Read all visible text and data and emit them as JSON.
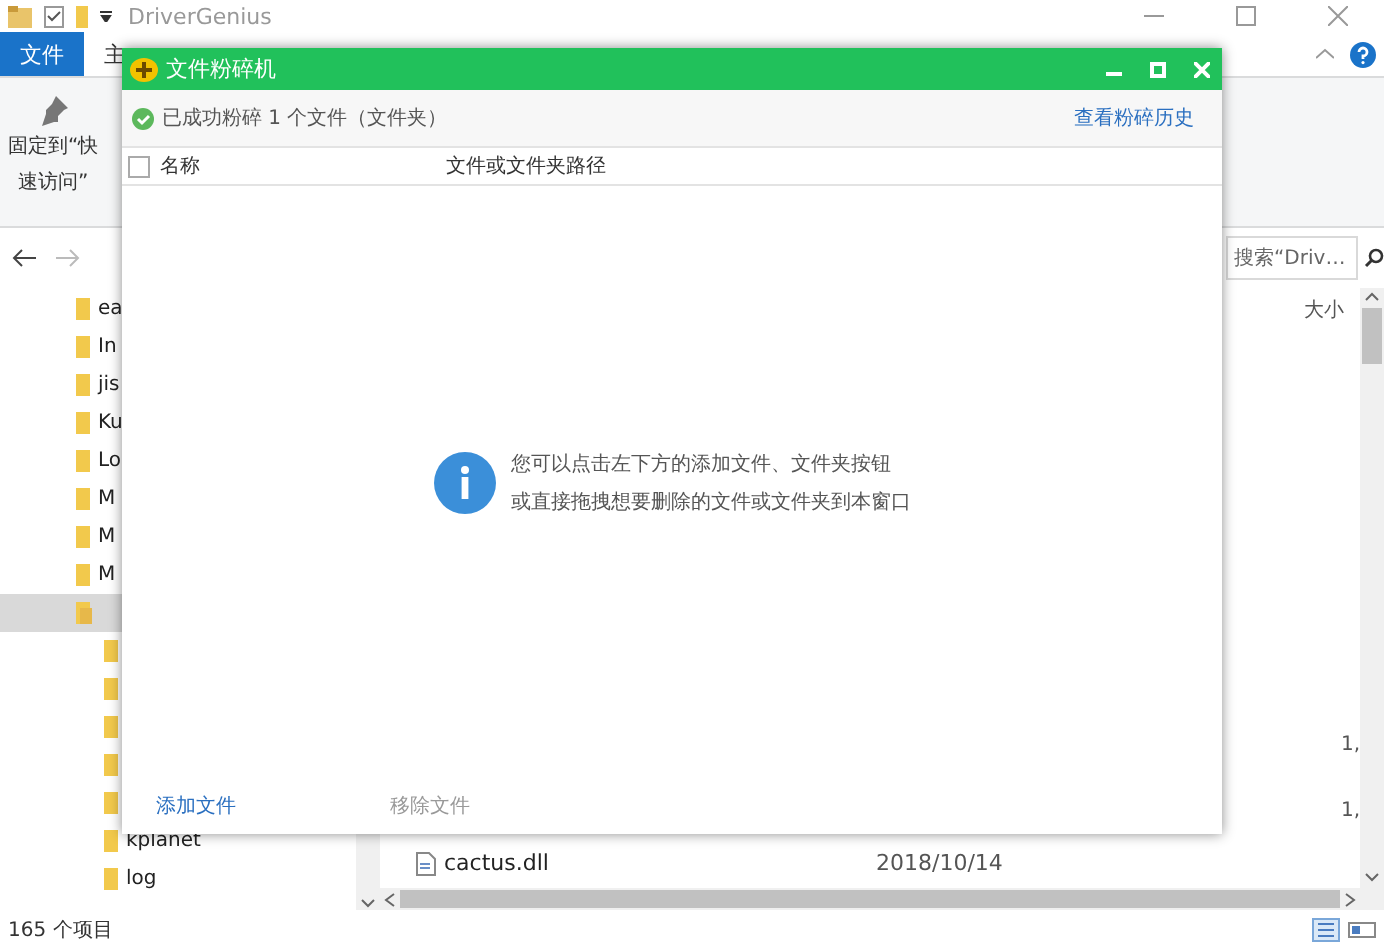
{
  "explorer": {
    "title": "DriverGenius",
    "ribbon_tabs": [
      {
        "label": "文件",
        "selected": true
      },
      {
        "label": "主",
        "selected": false
      }
    ],
    "ribbon_button": [
      "固定到“快",
      "速访问”"
    ],
    "search": {
      "placeholder": "搜索“Driv…"
    },
    "columns": [
      "大小"
    ],
    "nav_items": [
      {
        "kind": "folder",
        "label": "ea"
      },
      {
        "kind": "folder",
        "label": "In"
      },
      {
        "kind": "folder",
        "label": "jis"
      },
      {
        "kind": "folder",
        "label": "Ku"
      },
      {
        "kind": "folder",
        "label": "Lo"
      },
      {
        "kind": "folder",
        "label": "M"
      },
      {
        "kind": "folder",
        "label": "M"
      },
      {
        "kind": "folder",
        "label": "M"
      },
      {
        "kind": "open_folder",
        "selected": true,
        "children": [
          {
            "kind": "folder"
          },
          {
            "kind": "folder"
          },
          {
            "kind": "folder"
          },
          {
            "kind": "folder"
          },
          {
            "kind": "folder"
          },
          {
            "kind": "folder",
            "label": "kplanet"
          },
          {
            "kind": "folder",
            "label": "log"
          }
        ]
      }
    ],
    "files": [
      {
        "size": "1,"
      },
      {
        "size": "1,"
      },
      {
        "name": "cactus.dll",
        "date": "2018/10/14"
      }
    ],
    "status_bar": "165 个项目"
  },
  "dialog": {
    "title": "文件粉碎机",
    "status": "已成功粉碎 1 个文件（文件夹）",
    "history_link": "查看粉碎历史",
    "select_all": {
      "checked": false
    },
    "columns": [
      "名称",
      "文件或文件夹路径"
    ],
    "hint": [
      "您可以点击左下方的添加文件、文件夹按钮",
      "或直接拖拽想要删除的文件或文件夹到本窗口"
    ],
    "buttons": [
      {
        "label": "添加文件",
        "disabled": false
      },
      {
        "label": "移除文件",
        "disabled": true
      }
    ]
  }
}
